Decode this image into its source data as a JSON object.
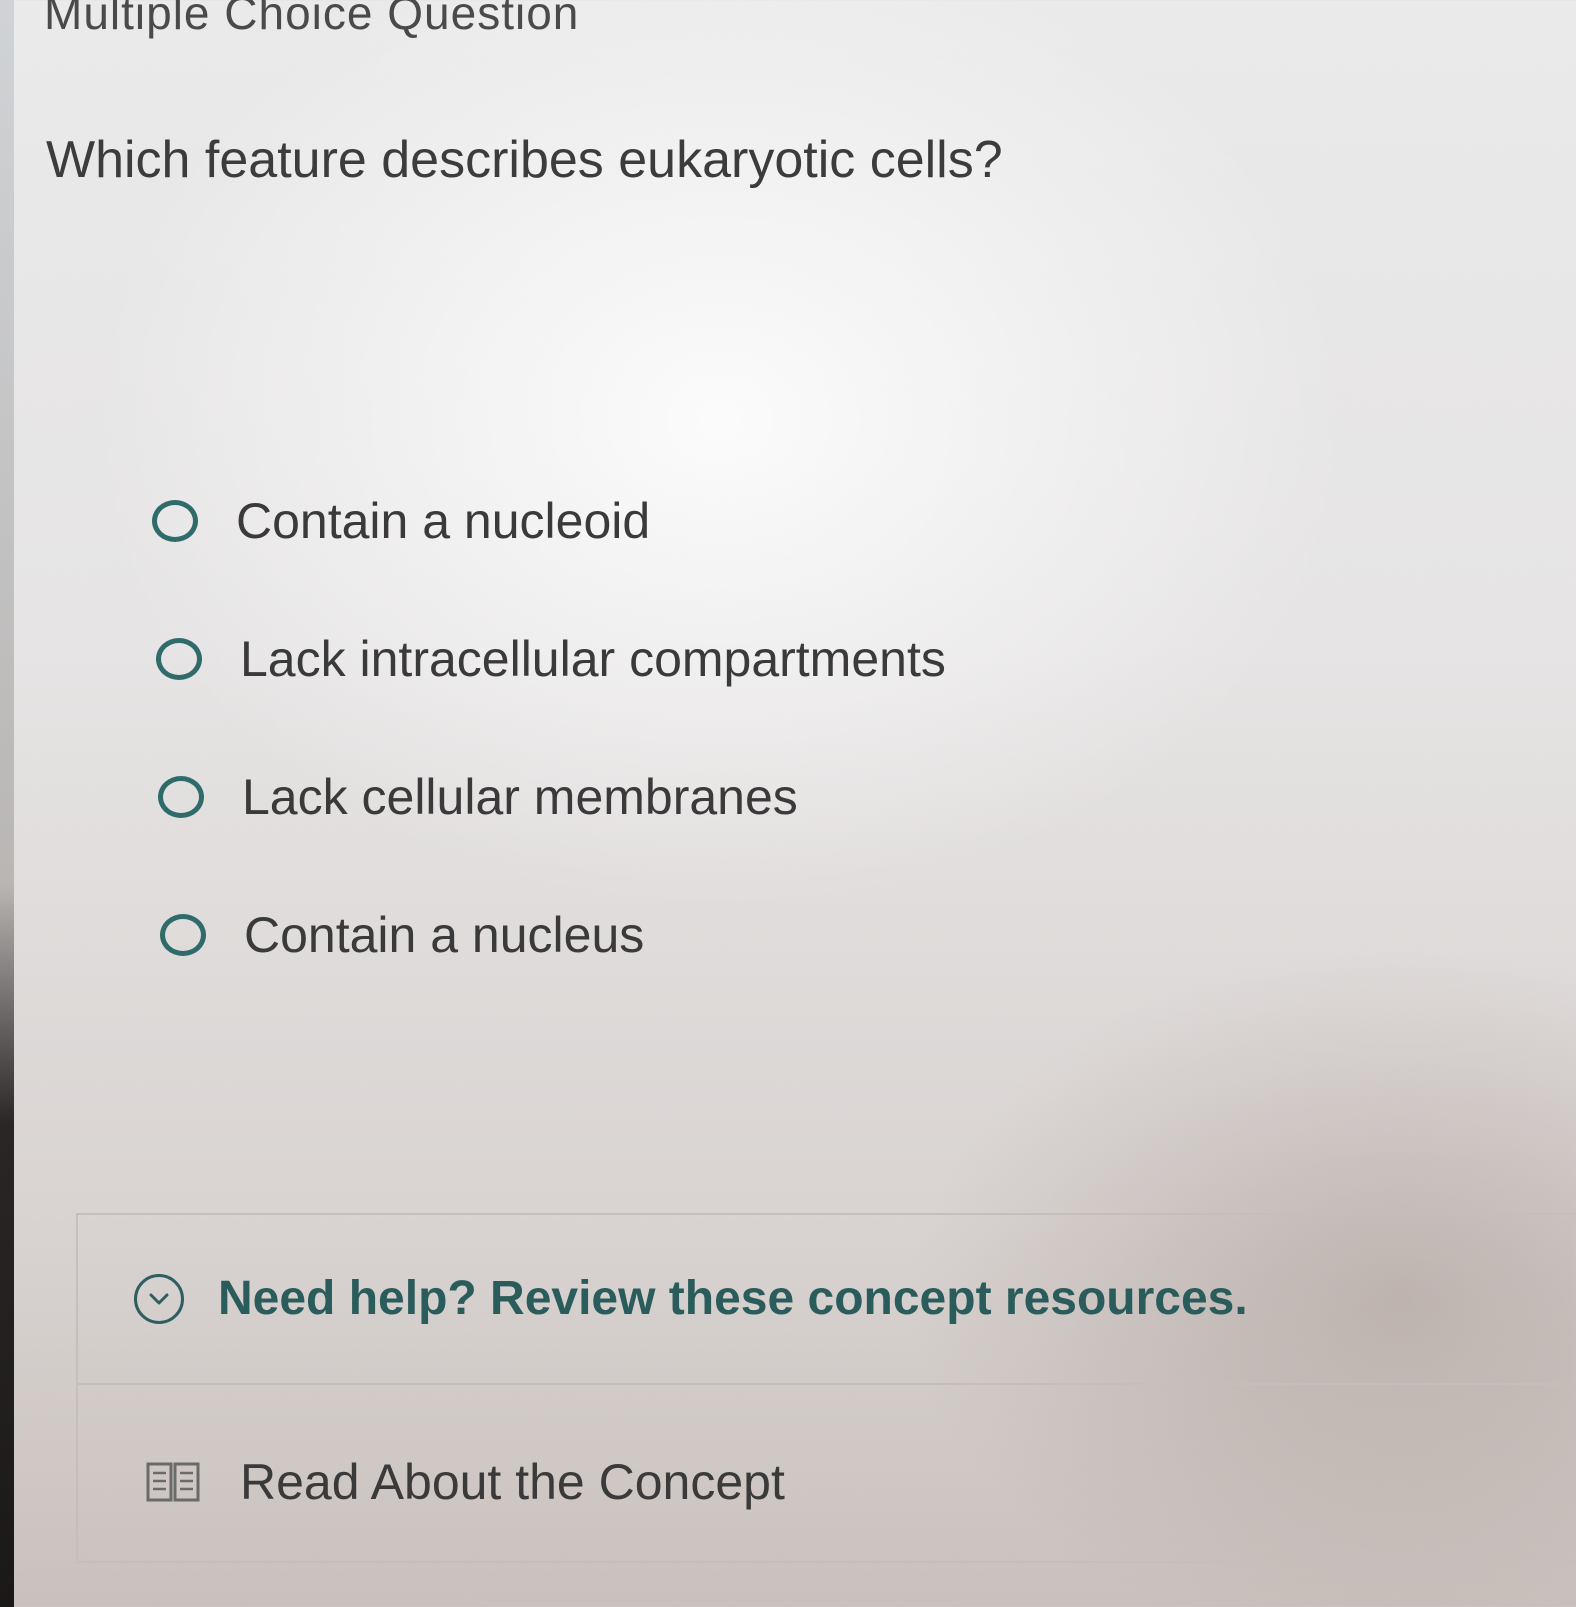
{
  "header": {
    "title": "Multiple Choice Question"
  },
  "question": {
    "text": "Which feature describes eukaryotic cells?"
  },
  "options": [
    {
      "label": "Contain a nucleoid",
      "selected": false
    },
    {
      "label": "Lack intracellular compartments",
      "selected": false
    },
    {
      "label": "Lack cellular membranes",
      "selected": false
    },
    {
      "label": "Contain a nucleus",
      "selected": false
    }
  ],
  "help": {
    "toggle_label": "Need help? Review these concept resources.",
    "toggle_icon": "chevron-down-circle-icon",
    "resources": [
      {
        "label": "Read About the Concept",
        "icon": "book-icon"
      }
    ]
  },
  "colors": {
    "accent": "#2f6b6b",
    "text": "#3a3a3a"
  }
}
